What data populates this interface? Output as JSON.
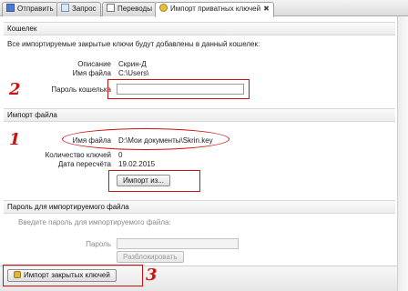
{
  "tabs": [
    {
      "label": "Отправить",
      "icon": "send-icon"
    },
    {
      "label": "Запрос",
      "icon": "request-icon"
    },
    {
      "label": "Переводы",
      "icon": "transfers-icon"
    },
    {
      "label": "Импорт приватных ключей",
      "icon": "key-icon",
      "active": true
    }
  ],
  "wallet": {
    "header": "Кошелек",
    "notice": "Все импортируемые закрытые ключи будут добавлены в данный кошелек:",
    "description_label": "Описание",
    "description_value": "Скрин-Д",
    "filename_label": "Имя файла",
    "filename_value": "C:\\Users\\",
    "password_label": "Пароль кошелька",
    "password_value": ""
  },
  "file_import": {
    "header": "Импорт файла",
    "filename_label": "Имя файла",
    "filename_value": "D:\\Мои документы\\Skrin.key",
    "key_count_label": "Количество ключей",
    "key_count_value": "0",
    "recalc_date_label": "Дата пересчёта",
    "recalc_date_value": "19.02.2015",
    "import_button": "Импорт из..."
  },
  "file_password": {
    "header": "Пароль для импортируемого файла",
    "prompt": "Введите пароль для импортируемого файла:",
    "password_label": "Пароль",
    "password_value": "",
    "unlock_button": "Разблокировать"
  },
  "footer": {
    "import_keys_button": "Импорт закрытых ключей"
  },
  "annotations": {
    "step1": "1",
    "step2": "2",
    "step3": "3",
    "color": "#cc1111"
  }
}
